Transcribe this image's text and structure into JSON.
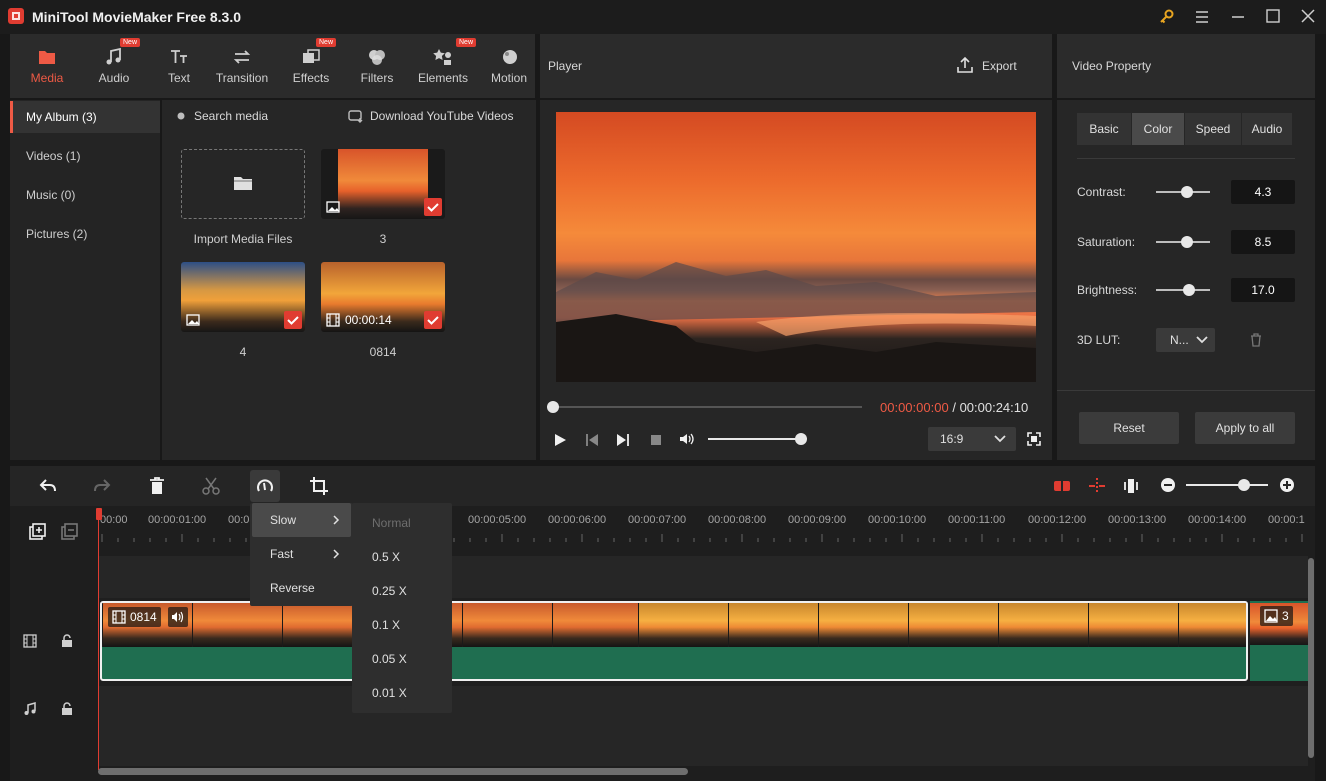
{
  "app": {
    "title": "MiniTool MovieMaker Free 8.3.0"
  },
  "toolbar": {
    "items": [
      {
        "label": "Media",
        "icon": "folder-icon",
        "active": true,
        "new": false
      },
      {
        "label": "Audio",
        "icon": "music-note-icon",
        "active": false,
        "new": true
      },
      {
        "label": "Text",
        "icon": "text-icon",
        "active": false,
        "new": false
      },
      {
        "label": "Transition",
        "icon": "transition-arrows-icon",
        "active": false,
        "new": false
      },
      {
        "label": "Effects",
        "icon": "effects-icon",
        "active": false,
        "new": true
      },
      {
        "label": "Filters",
        "icon": "filters-icon",
        "active": false,
        "new": false
      },
      {
        "label": "Elements",
        "icon": "elements-icon",
        "active": false,
        "new": true
      },
      {
        "label": "Motion",
        "icon": "motion-icon",
        "active": false,
        "new": false
      }
    ],
    "new_badge": "New"
  },
  "left_nav": {
    "items": [
      {
        "label": "My Album (3)",
        "active": true
      },
      {
        "label": "Videos (1)",
        "active": false
      },
      {
        "label": "Music (0)",
        "active": false
      },
      {
        "label": "Pictures (2)",
        "active": false
      }
    ]
  },
  "media": {
    "search_label": "Search media",
    "download_label": "Download YouTube Videos",
    "import_label": "Import Media Files",
    "items": [
      {
        "caption": "3",
        "type": "image"
      },
      {
        "caption": "4",
        "type": "image"
      },
      {
        "caption": "0814",
        "type": "video",
        "duration": "00:00:14"
      }
    ]
  },
  "player": {
    "title": "Player",
    "export_label": "Export",
    "current_time": "00:00:00:00",
    "separator": "/",
    "total_time": "00:00:24:10",
    "aspect_ratio": "16:9",
    "progress": 0,
    "volume": 1.0
  },
  "property": {
    "title": "Video Property",
    "tabs": [
      {
        "label": "Basic",
        "active": false
      },
      {
        "label": "Color",
        "active": true
      },
      {
        "label": "Speed",
        "active": false
      },
      {
        "label": "Audio",
        "active": false
      }
    ],
    "contrast": {
      "label": "Contrast:",
      "value": "4.3",
      "level": 0.6
    },
    "saturation": {
      "label": "Saturation:",
      "value": "8.5",
      "level": 0.58
    },
    "brightness": {
      "label": "Brightness:",
      "value": "17.0",
      "level": 0.62
    },
    "lut": {
      "label": "3D LUT:",
      "value": "N..."
    },
    "reset_label": "Reset",
    "apply_label": "Apply to all"
  },
  "timeline": {
    "ticks": [
      "00:00",
      "00:00:01:00",
      "00:0",
      "00:00:05:00",
      "00:00:06:00",
      "00:00:07:00",
      "00:00:08:00",
      "00:00:09:00",
      "00:00:10:00",
      "00:00:11:00",
      "00:00:12:00",
      "00:00:13:00",
      "00:00:14:00",
      "00:00:1"
    ],
    "clip_video_label": "0814",
    "clip_image_label": "3",
    "zoom_level": 0.78
  },
  "speed_menu": {
    "items": [
      {
        "label": "Slow",
        "has_submenu": true,
        "active": true
      },
      {
        "label": "Fast",
        "has_submenu": true,
        "active": false
      },
      {
        "label": "Reverse",
        "has_submenu": false,
        "active": false
      }
    ],
    "submenu": [
      "Normal",
      "0.5 X",
      "0.25 X",
      "0.1 X",
      "0.05 X",
      "0.01 X"
    ]
  }
}
